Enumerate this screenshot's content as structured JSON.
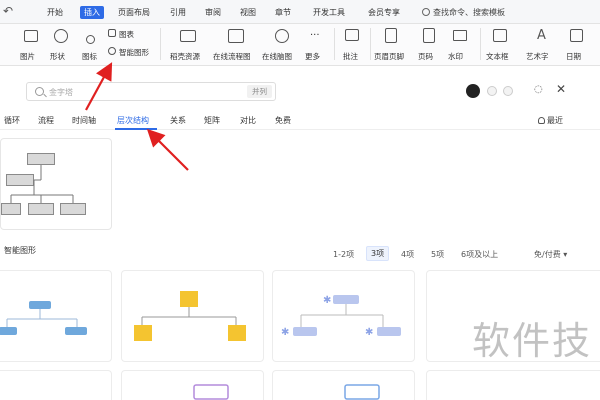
{
  "menubar": {
    "items": [
      "开始",
      "插入",
      "页面布局",
      "引用",
      "审阅",
      "视图",
      "章节",
      "开发工具",
      "会员专享"
    ],
    "active_item": "插入",
    "search_command": "查找命令、搜索模板"
  },
  "toolbar": {
    "items": [
      {
        "label": "图片",
        "icon": "image-icon"
      },
      {
        "label": "形状",
        "icon": "shape-icon"
      },
      {
        "label": "图标",
        "icon": "icon-library-icon"
      },
      {
        "label": "图表",
        "icon": "chart-icon"
      },
      {
        "label": "智能图形",
        "icon": "smartart-icon"
      },
      {
        "label": "稻壳资源",
        "icon": "resource-icon"
      },
      {
        "label": "在线流程图",
        "icon": "flowchart-icon"
      },
      {
        "label": "在线脑图",
        "icon": "mindmap-icon"
      },
      {
        "label": "更多",
        "icon": "more-icon"
      },
      {
        "label": "批注",
        "icon": "comment-icon"
      },
      {
        "label": "页眉页脚",
        "icon": "header-footer-icon"
      },
      {
        "label": "页码",
        "icon": "page-number-icon"
      },
      {
        "label": "水印",
        "icon": "watermark-icon"
      },
      {
        "label": "文本框",
        "icon": "textbox-icon"
      },
      {
        "label": "艺术字",
        "icon": "wordart-icon"
      },
      {
        "label": "日期",
        "icon": "date-icon"
      }
    ]
  },
  "dialog": {
    "search": {
      "placeholder": "金字塔",
      "button": "并列"
    },
    "tabs": [
      "循环",
      "流程",
      "时间轴",
      "层次结构",
      "关系",
      "矩阵",
      "对比",
      "免费"
    ],
    "active_tab": "层次结构",
    "recent_label": "最近",
    "section_title": "智能图形",
    "filters": [
      "1-2项",
      "3项",
      "4项",
      "5项",
      "6项及以上"
    ],
    "active_filter": "3项",
    "price_filter": "免/付费"
  },
  "watermark_text": "软件技",
  "colors": {
    "accent": "#2e6be6",
    "annotation_arrow": "#e02020",
    "template_blue": "#6fa8dc",
    "template_yellow": "#f4c430",
    "template_lavender": "#b9c6ee"
  }
}
